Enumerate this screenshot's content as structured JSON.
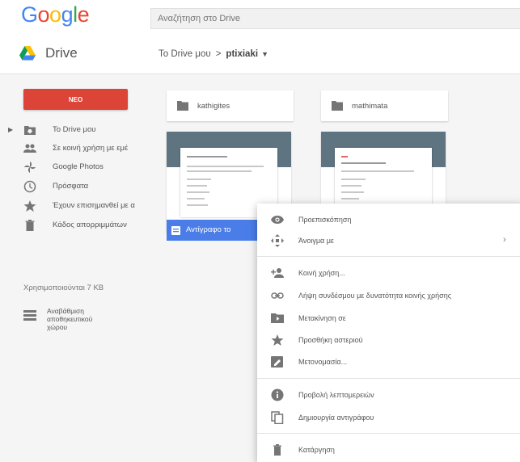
{
  "header": {
    "logo": [
      "G",
      "o",
      "o",
      "g",
      "l",
      "e"
    ],
    "logo_colors": [
      "#4285f4",
      "#ea4335",
      "#fbbc05",
      "#4285f4",
      "#34a853",
      "#ea4335"
    ],
    "search_placeholder": "Αναζήτηση στο Drive"
  },
  "subbar": {
    "app_name": "Drive",
    "breadcrumb_root": "Το Drive μου",
    "breadcrumb_sep": ">",
    "breadcrumb_current": "ptixiaki",
    "breadcrumb_caret": "▼"
  },
  "sidebar": {
    "new_label": "ΝΕΟ",
    "expander": "▶",
    "items": [
      {
        "label": "Το Drive μου",
        "icon": "folder-drive-icon"
      },
      {
        "label": "Σε κοινή χρήση με εμέ",
        "icon": "shared-people-icon"
      },
      {
        "label": "Google Photos",
        "icon": "pinwheel-icon"
      },
      {
        "label": "Πρόσφατα",
        "icon": "clock-icon"
      },
      {
        "label": "Έχουν επισημανθεί με α",
        "icon": "star-icon"
      },
      {
        "label": "Κάδος απορριμμάτων",
        "icon": "trash-icon"
      }
    ],
    "storage_text": "Χρησιμοποιούνται 7 KB",
    "buy_storage_lines": [
      "Αναβάθμιση",
      "αποθηκευτικού",
      "χώρου"
    ]
  },
  "folders": [
    {
      "name": "kathigites",
      "icon": "folder-icon"
    },
    {
      "name": "mathimata",
      "icon": "folder-icon"
    }
  ],
  "selected_file": {
    "name": "Αντίγραφο το",
    "icon": "forms-icon"
  },
  "context_menu": {
    "items": [
      {
        "label": "Προεπισκόπηση",
        "icon": "eye-icon"
      },
      {
        "label": "Άνοιγμα με",
        "icon": "open-with-icon",
        "submenu_arrow": "›"
      },
      {
        "label": "Κοινή χρήση...",
        "icon": "person-add-icon"
      },
      {
        "label": "Λήψη συνδέσμου με δυνατότητα κοινής χρήσης",
        "icon": "link-icon"
      },
      {
        "label": "Μετακίνηση σε",
        "icon": "move-folder-icon"
      },
      {
        "label": "Προσθήκη αστεριού",
        "icon": "star-icon"
      },
      {
        "label": "Μετονομασία...",
        "icon": "rename-icon"
      },
      {
        "label": "Προβολή λεπτομερειών",
        "icon": "info-icon"
      },
      {
        "label": "Δημιουργία αντιγράφου",
        "icon": "copy-icon"
      },
      {
        "label": "Κατάργηση",
        "icon": "trash-icon"
      }
    ]
  },
  "colors": {
    "new_button": "#db4437",
    "selected_file": "#4a7de8",
    "file_band": "#5f7481",
    "icon_gray": "#757575"
  }
}
